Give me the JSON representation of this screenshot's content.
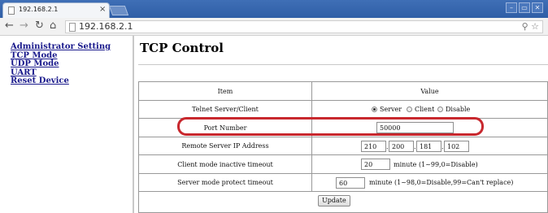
{
  "browser": {
    "tab_title": "192.168.2.1",
    "tab_close": "×",
    "url": "192.168.2.1",
    "window_controls": [
      "–",
      "▭",
      "✕"
    ],
    "nav_icons": [
      "back-arrow-icon",
      "forward-arrow-icon",
      "reload-icon",
      "home-icon"
    ],
    "omnibox_icons": [
      "key-icon",
      "star-icon"
    ]
  },
  "sidebar": {
    "items": [
      {
        "label": "Administrator Setting"
      },
      {
        "label": "TCP Mode"
      },
      {
        "label": "UDP Mode"
      },
      {
        "label": "UART"
      },
      {
        "label": "Reset Device"
      }
    ]
  },
  "main": {
    "title": "TCP Control",
    "table": {
      "headers": [
        "Item",
        "Value"
      ],
      "telnet": {
        "label": "Telnet Server/Client",
        "options": [
          "Server",
          "Client",
          "Disable"
        ],
        "selected": "Server"
      },
      "port": {
        "label": "Port Number",
        "value": "50000"
      },
      "remote_ip": {
        "label": "Remote Server IP Address",
        "octets": [
          "210",
          "200",
          "181",
          "102"
        ]
      },
      "client_timeout": {
        "label": "Client mode inactive timeout",
        "value": "20",
        "hint": "minute (1~99,0=Disable)"
      },
      "server_timeout": {
        "label": "Server mode protect timeout",
        "value": "60",
        "hint": "minute (1~98,0=Disable,99=Can't replace)"
      },
      "update_label": "Update"
    },
    "annotation_color": "#c8282e"
  }
}
